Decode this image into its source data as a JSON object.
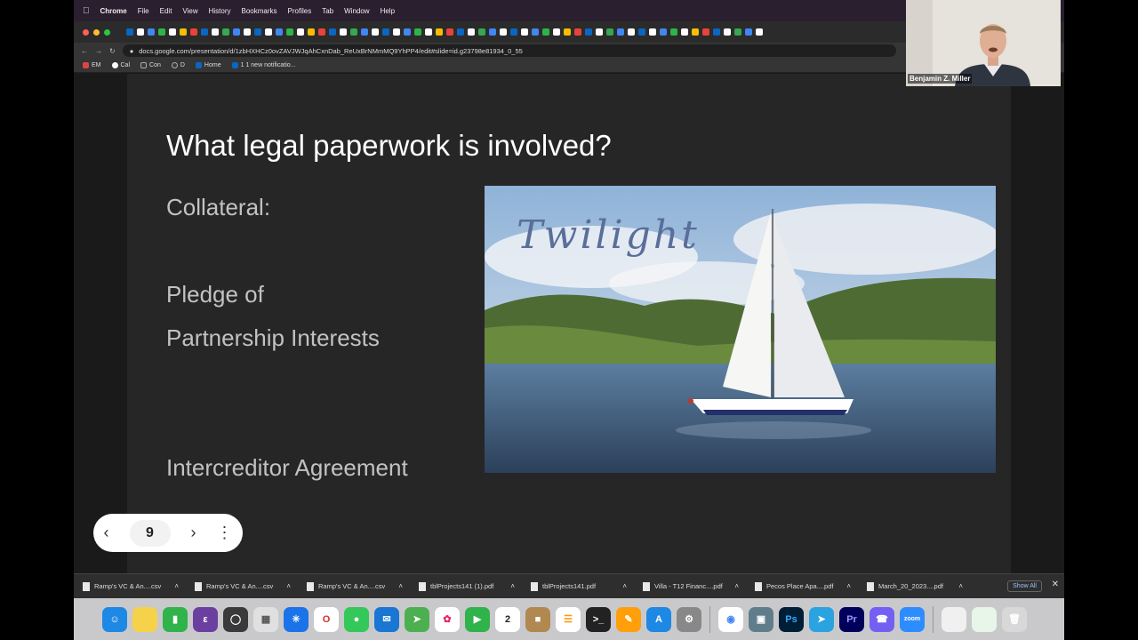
{
  "menubar": {
    "app": "Chrome",
    "items": [
      "File",
      "Edit",
      "View",
      "History",
      "Bookmarks",
      "Profiles",
      "Tab",
      "Window",
      "Help"
    ]
  },
  "browser": {
    "url": "docs.google.com/presentation/d/1zbHXHCz0ovZAVJWJqAhCxnDab_ReUxBrNMmMQ9YhPP4/edit#slide=id.g23798e81934_0_55",
    "bookmarks": [
      "EM",
      "Cal",
      "Con",
      "D",
      "Home",
      "1 1 new notificatio..."
    ]
  },
  "slide": {
    "title": "What legal paperwork is involved?",
    "lines": [
      "Collateral:",
      "Pledge of",
      "Partnership Interests",
      "Intercreditor Agreement"
    ],
    "image_caption": "Twilight"
  },
  "slide_nav": {
    "page": "9"
  },
  "downloads": {
    "files": [
      "Ramp's VC & An....csv",
      "Ramp's VC & An....csv",
      "Ramp's VC & An....csv",
      "tblProjects141 (1).pdf",
      "tblProjects141.pdf",
      "Villa - T12 Financ....pdf",
      "Pecos Place Apa....pdf",
      "March_20_2023....pdf"
    ],
    "show_all": "Show All"
  },
  "dock": {
    "calendar_day": "2",
    "ps": "Ps",
    "pr": "Pr",
    "zoom": "zoom"
  },
  "webcam": {
    "name": "Benjamin Z. Miller"
  }
}
